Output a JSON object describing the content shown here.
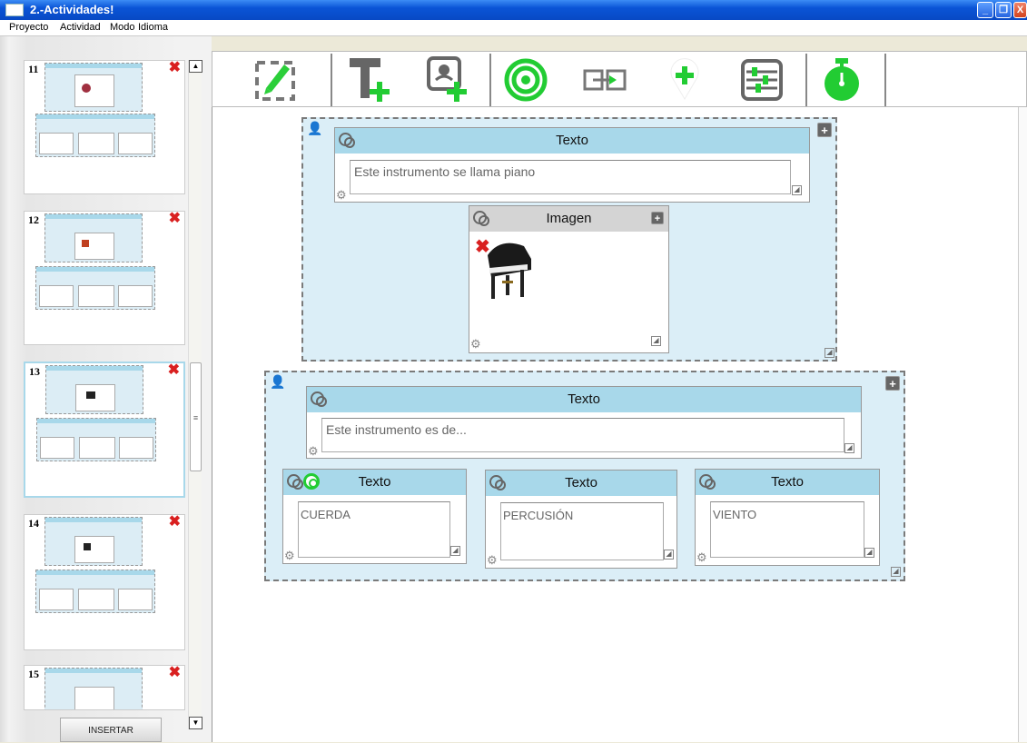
{
  "window": {
    "title": "2.-Actividades!",
    "buttons": [
      "_",
      "❐",
      "X"
    ]
  },
  "menu": [
    "Proyecto",
    "Actividad",
    "Modo",
    "Idioma"
  ],
  "sidebar": {
    "slides": [
      {
        "num": "11"
      },
      {
        "num": "12"
      },
      {
        "num": "13"
      },
      {
        "num": "14"
      },
      {
        "num": "15"
      }
    ],
    "insert_label": "INSERTAR"
  },
  "toolbar": {
    "tools": [
      "edit-frame-icon",
      "add-text-icon",
      "add-image-icon",
      "target-icon",
      "connect-icon",
      "add-marker-icon",
      "mixer-icon",
      "timer-icon"
    ]
  },
  "canvas": {
    "group1": {
      "text_card": {
        "header": "Texto",
        "value": "Este instrumento se llama piano"
      },
      "image_card": {
        "header": "Imagen"
      }
    },
    "group2": {
      "text_card": {
        "header": "Texto",
        "value": "Este instrumento es de..."
      },
      "options": [
        {
          "header": "Texto",
          "value": "CUERDA"
        },
        {
          "header": "Texto",
          "value": "PERCUSIÓN"
        },
        {
          "header": "Texto",
          "value": "VIENTO"
        }
      ]
    }
  },
  "colors": {
    "accent": "#a8d8ea",
    "group_bg": "#dbeef7",
    "green": "#22cc33",
    "delete": "#d92020"
  }
}
